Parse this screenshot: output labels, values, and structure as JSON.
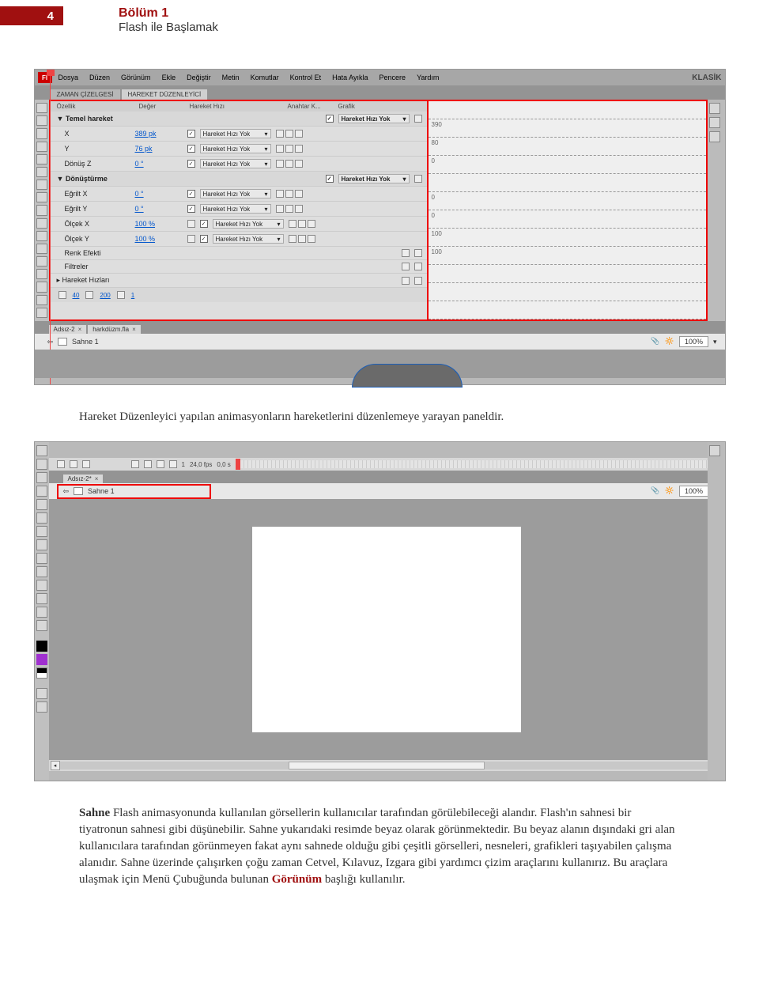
{
  "header": {
    "page_number": "4",
    "chapter": "Bölüm 1",
    "subtitle": "Flash ile Başlamak"
  },
  "menubar": {
    "logo": "Fl",
    "items": [
      "Dosya",
      "Düzen",
      "Görünüm",
      "Ekle",
      "Değiştir",
      "Metin",
      "Komutlar",
      "Kontrol Et",
      "Hata Ayıkla",
      "Pencere",
      "Yardım"
    ],
    "workspace": "KLASİK"
  },
  "panel_tabs": {
    "timeline": "ZAMAN ÇİZELGESİ",
    "motion": "HAREKET DÜZENLEYİCİ"
  },
  "prop_header": {
    "name": "Özellik",
    "value": "Değer",
    "ease": "Hareket Hızı",
    "keyframe": "Anahtar K...",
    "graph": "Grafik"
  },
  "ease_label": "Hareket Hızı Yok",
  "motion_rows": {
    "group1": "Temel hareket",
    "x": {
      "name": "X",
      "value": "389 pk",
      "graph": "390"
    },
    "y": {
      "name": "Y",
      "value": "76 pk",
      "graph": "80"
    },
    "rotz": {
      "name": "Dönüş Z",
      "value": "0 °",
      "graph": "0"
    },
    "group2": "Dönüştürme",
    "skewx": {
      "name": "Eğrilt X",
      "value": "0 °",
      "graph": "0"
    },
    "skewy": {
      "name": "Eğrilt Y",
      "value": "0 °",
      "graph": "0"
    },
    "scalex": {
      "name": "Ölçek X",
      "value": "100 %",
      "graph": "100"
    },
    "scaley": {
      "name": "Ölçek Y",
      "value": "100 %",
      "graph": "100"
    },
    "color": "Renk Efekti",
    "filters": "Filtreler",
    "eases": "Hareket Hızları"
  },
  "bottom_bar": {
    "a": "40",
    "b": "200",
    "c": "1"
  },
  "doc_tabs": {
    "t1": "Adsız-2",
    "t2": "harkdüzm.fla",
    "t3": "Adsız-2*"
  },
  "scene_bar": {
    "scene": "Sahne 1",
    "zoom": "100%"
  },
  "timeline_info": {
    "frame": "1",
    "fps": "24,0 fps",
    "time": "0,0 s"
  },
  "body": {
    "p1": "Hareket Düzenleyici yapılan animasyonların hareketlerini düzenlemeye yarayan paneldir.",
    "p2_a": "Sahne",
    "p2_b": " Flash animasyonunda kullanılan görsellerin kullanıcılar tarafından görülebileceği alandır. Flash'ın sahnesi bir tiyatronun sahnesi gibi düşünebilir. Sahne yukarıdaki resimde beyaz olarak görünmektedir. Bu beyaz alanın dışındaki gri alan kullanıcılara tarafından görünmeyen fakat aynı sahnede olduğu gibi çeşitli görselleri, nesneleri, grafikleri taşıyabilen çalışma alanıdır. Sahne üzerinde çalışırken çoğu zaman Cetvel, Kılavuz, Izgara gibi yardımcı çizim araçlarını kullanırız. Bu araçlara ulaşmak için Menü Çubuğunda bulunan ",
    "p2_c": "Görünüm",
    "p2_d": " başlığı kullanılır."
  }
}
